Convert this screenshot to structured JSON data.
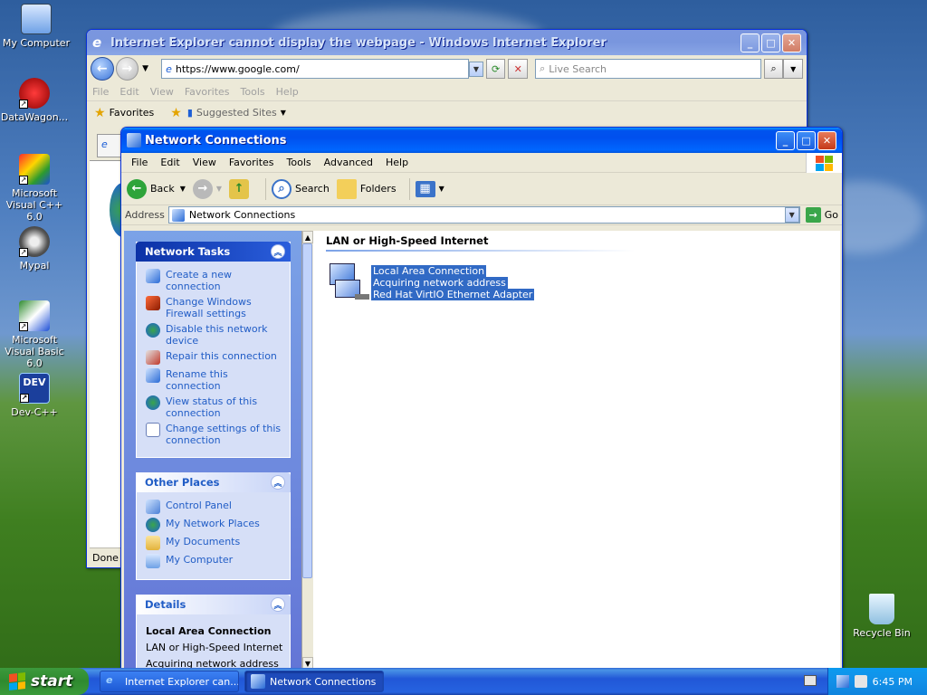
{
  "desktop": {
    "icons": [
      {
        "label": "My Computer"
      },
      {
        "label": "DataWagon..."
      },
      {
        "label": "Microsoft Visual C++ 6.0"
      },
      {
        "label": "Mypal"
      },
      {
        "label": "Microsoft Visual Basic 6.0"
      },
      {
        "label": "Dev-C++"
      },
      {
        "label": "Recycle Bin"
      }
    ],
    "dev_badge": "DEV"
  },
  "ie": {
    "title": "Internet Explorer cannot display the webpage - Windows Internet Explorer",
    "url": "https://www.google.com/",
    "search_placeholder": "Live Search",
    "menu": [
      "File",
      "Edit",
      "View",
      "Favorites",
      "Tools",
      "Help"
    ],
    "favorites_label": "Favorites",
    "suggested_sites": "Suggested Sites",
    "status": "Done"
  },
  "nc": {
    "title": "Network Connections",
    "menu": [
      "File",
      "Edit",
      "View",
      "Favorites",
      "Tools",
      "Advanced",
      "Help"
    ],
    "toolbar": {
      "back": "Back",
      "search": "Search",
      "folders": "Folders"
    },
    "address_label": "Address",
    "address_value": "Network Connections",
    "go_label": "Go",
    "network_tasks": {
      "title": "Network Tasks",
      "items": [
        "Create a new connection",
        "Change Windows Firewall settings",
        "Disable this network device",
        "Repair this connection",
        "Rename this connection",
        "View status of this connection",
        "Change settings of this connection"
      ]
    },
    "other_places": {
      "title": "Other Places",
      "items": [
        "Control Panel",
        "My Network Places",
        "My Documents",
        "My Computer"
      ]
    },
    "details": {
      "title": "Details",
      "name": "Local Area Connection",
      "type": "LAN or High-Speed Internet",
      "status": "Acquiring network address"
    },
    "group_heading": "LAN or High-Speed Internet",
    "connection": {
      "name": "Local Area Connection",
      "status": "Acquiring network address",
      "device": "Red Hat VirtIO Ethernet Adapter"
    }
  },
  "taskbar": {
    "start_label": "start",
    "buttons": [
      "Internet Explorer can...",
      "Network Connections"
    ],
    "clock": "6:45 PM"
  }
}
